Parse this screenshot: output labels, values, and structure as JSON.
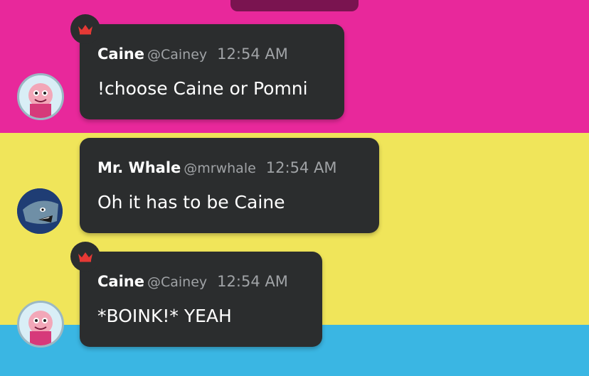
{
  "messages": [
    {
      "name": "Caine",
      "handle": "@Cainey",
      "time": "12:54 AM",
      "text": "!choose Caine or Pomni",
      "badge": "crown-icon"
    },
    {
      "name": "Mr. Whale",
      "handle": "@mrwhale",
      "time": "12:54 AM",
      "text": "Oh it has to be Caine"
    },
    {
      "name": "Caine",
      "handle": "@Cainey",
      "time": "12:54 AM",
      "text": "*BOINK!* YEAH",
      "badge": "crown-icon"
    }
  ],
  "colors": {
    "band_pink": "#e8289b",
    "band_yellow": "#f0e55a",
    "band_blue": "#3ab6e3",
    "bubble": "#2b2d2e",
    "crown": "#e53935",
    "muted_text": "#a0a3a6"
  }
}
